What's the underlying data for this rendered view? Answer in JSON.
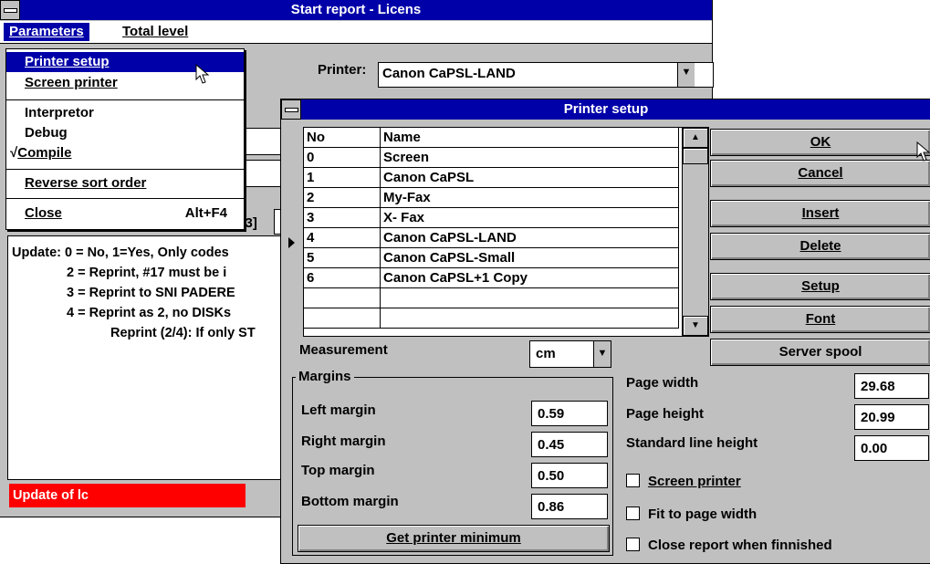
{
  "main": {
    "title": "Start report - Licens",
    "menu": {
      "parameters": "Parameters",
      "total_level": "Total level"
    },
    "printer_label": "Printer:",
    "printer_value": "Canon CaPSL-LAND",
    "partial_label": "2/3]",
    "text_lines": [
      "Update: 0 = No, 1=Yes, Only codes",
      "2 = Reprint, #17 must be i",
      "3 = Reprint to SNI PADERE",
      "4 = Reprint as 2, no DISKs",
      "Reprint (2/4): If only ST"
    ],
    "status": "Update of lc"
  },
  "dropdown": {
    "items": {
      "printer_setup": "Printer setup",
      "screen_printer": "Screen printer",
      "interpretor": "Interpretor",
      "debug": "Debug",
      "compile": "Compile",
      "compile_check": "√",
      "reverse_sort": "Reverse sort order",
      "close": "Close",
      "close_shortcut": "Alt+F4"
    }
  },
  "dialog": {
    "title": "Printer setup",
    "columns": {
      "no": "No",
      "name": "Name"
    },
    "rows": [
      {
        "no": "0",
        "name": "Screen"
      },
      {
        "no": "1",
        "name": "Canon CaPSL"
      },
      {
        "no": "2",
        "name": "My-Fax"
      },
      {
        "no": "3",
        "name": "X- Fax"
      },
      {
        "no": "4",
        "name": "Canon CaPSL-LAND"
      },
      {
        "no": "5",
        "name": "Canon CaPSL-Small"
      },
      {
        "no": "6",
        "name": "Canon CaPSL+1 Copy"
      }
    ],
    "buttons": {
      "ok": "OK",
      "cancel": "Cancel",
      "insert": "Insert",
      "delete": "Delete",
      "setup": "Setup",
      "font": "Font",
      "server_spool": "Server spool",
      "get_printer_minimum": "Get printer minimum"
    },
    "measurement_label": "Measurement",
    "measurement_value": "cm",
    "margins_title": "Margins",
    "margins": {
      "left_label": "Left margin",
      "left_value": "0.59",
      "right_label": "Right margin",
      "right_value": "0.45",
      "top_label": "Top margin",
      "top_value": "0.50",
      "bottom_label": "Bottom margin",
      "bottom_value": "0.86"
    },
    "page": {
      "width_label": "Page width",
      "width_value": "29.68",
      "height_label": "Page height",
      "height_value": "20.99",
      "line_label": "Standard line height",
      "line_value": "0.00"
    },
    "checkboxes": {
      "screen_printer": "Screen printer",
      "fit_width": "Fit to page width",
      "close_report": "Close report when finnished"
    }
  }
}
